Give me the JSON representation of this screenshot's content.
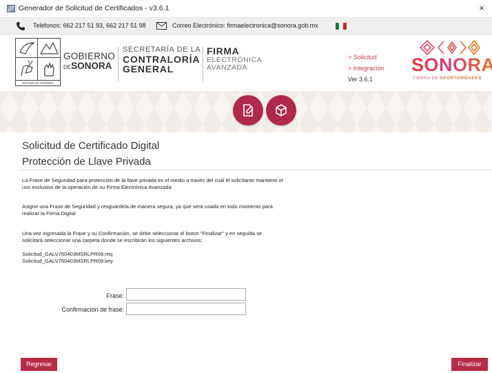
{
  "window": {
    "title": "Generador de Solicitud de Certificados - v3.6.1",
    "close_glyph": "×"
  },
  "contact": {
    "phone": "Teléfonos: 662 217 51 93, 662 217 51 98",
    "email": "Correo Electrónico: firmaelectronica@sonora.gob.mx"
  },
  "header": {
    "crest_caption": "ESTADO de SONORA",
    "gobierno_line1": "GOBIERNO",
    "gobierno_de": "DE",
    "gobierno_line2": "SONORA",
    "secretaria_line1": "SECRETARÍA DE LA",
    "secretaria_line2": "CONTRALORÍA",
    "secretaria_line3": "GENERAL",
    "firma_line1": "FIRMA",
    "firma_line2": "ELECTRÓNICA",
    "firma_line3": "AVANZADA",
    "steps": [
      "> Solicitud",
      "> Integración"
    ],
    "version": "Ver 3.6.1",
    "sonora_word": "SONORA",
    "sonora_tag_1": "TIERRA DE ",
    "sonora_tag_2": "OPORTUNIDADES"
  },
  "main": {
    "title": "Solicitud de Certificado Digital",
    "subtitle": "Protección de Llave Privada",
    "paragraph1": "La Frase de Seguridad para protección de la llave privada es el medio a través del cual el solicitante mantiene el uso exclusivo de la operación de su Firma Electrónica Avanzada",
    "paragraph2": "Asigne una Frase de Seguridad y resguárdela de manera segura, ya que será usada en todo momento para realizar la Firma Digital",
    "paragraph3": "Una vez ingresada la Frase y su Confirmación, se debe seleccionar el boton \"Finalizar\" y en seguida se solicitará seleccionar una carpeta donde se escribirán los siguientes archivos:",
    "file_req": "Solicitud_GALV760403MSRLPR09.req",
    "file_key": "Solicitud_GALV760403MSRLPR09.key"
  },
  "form": {
    "frase_label": "Frase:",
    "frase_value": "",
    "confirm_label": "Confirmación de frase:",
    "confirm_value": ""
  },
  "buttons": {
    "back": "Regresar",
    "finish": "Finalizar"
  },
  "colors": {
    "accent": "#b72b47",
    "circle": "#b0294a",
    "link": "#c1424e"
  },
  "icons": [
    "app-icon",
    "phone-icon",
    "mail-icon",
    "mexico-flag-icon",
    "document-edit-icon",
    "cube-icon",
    "close-icon"
  ]
}
